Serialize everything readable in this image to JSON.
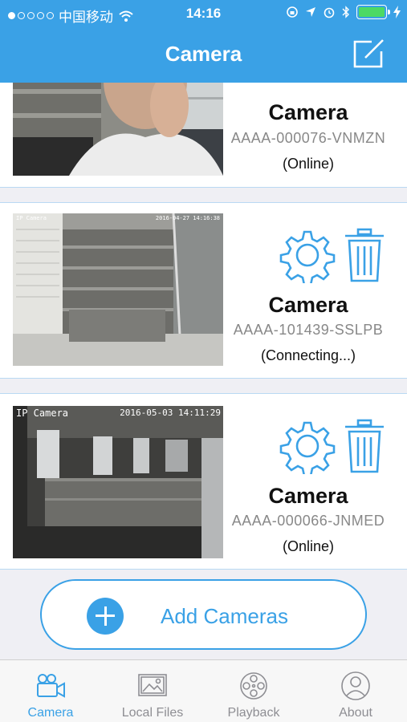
{
  "status_bar": {
    "carrier": "中国移动",
    "time": "14:16"
  },
  "nav": {
    "title": "Camera",
    "edit_icon": "edit-square-icon"
  },
  "cameras": [
    {
      "name": "Camera",
      "uid": "AAAA-000076-VNMZN",
      "state": "(Online)"
    },
    {
      "name": "Camera",
      "uid": "AAAA-101439-SSLPB",
      "state": "(Connecting...)",
      "overlay_left": "IP Camera",
      "overlay_right": "2016-04-27 14:16:38"
    },
    {
      "name": "Camera",
      "uid": "AAAA-000066-JNMED",
      "state": "(Online)",
      "overlay_left": "IP Camera",
      "overlay_right": "2016-05-03 14:11:29"
    }
  ],
  "add_button": {
    "label": "Add Cameras"
  },
  "tabs": [
    {
      "label": "Camera",
      "icon": "video-camera-icon",
      "active": true
    },
    {
      "label": "Local Files",
      "icon": "image-icon",
      "active": false
    },
    {
      "label": "Playback",
      "icon": "film-reel-icon",
      "active": false
    },
    {
      "label": "About",
      "icon": "user-icon",
      "active": false
    }
  ],
  "colors": {
    "accent": "#3aa1e6",
    "battery": "#4cd964",
    "background": "#efeff4"
  }
}
